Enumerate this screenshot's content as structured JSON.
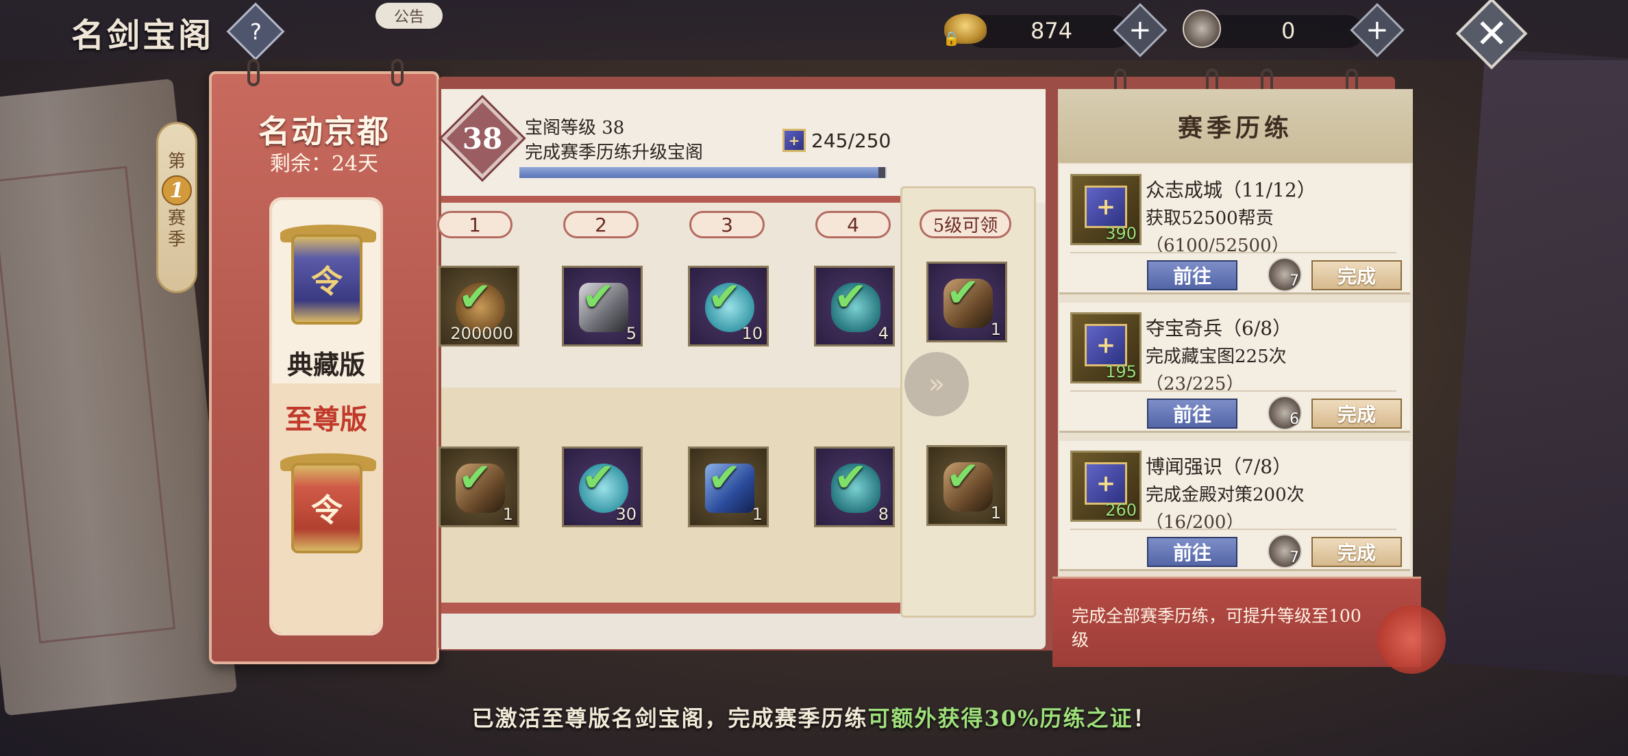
{
  "header": {
    "title": "名剑宝阁",
    "help_label": "?",
    "notice_tab": "公告",
    "currency_gold": {
      "value": "874",
      "icon": "gold-ingot-icon",
      "locked": true
    },
    "currency_key": {
      "value": "0",
      "icon": "key-token-icon"
    },
    "plus_label": "+",
    "close_label": "✕"
  },
  "season": {
    "prefix": "第",
    "number": "1",
    "suffix_1": "赛",
    "suffix_2": "季"
  },
  "left_panel": {
    "title": "名动京都",
    "remaining": "剩余：24天",
    "edition_collect": "典藏版",
    "edition_supreme": "至尊版",
    "lantern_char": "令"
  },
  "pass": {
    "level": "38",
    "level_label": "宝阁等级 38",
    "upgrade_hint": "完成赛季历练升级宝阁",
    "exp": "245/250",
    "exp_progress": 0.98,
    "level_tags": [
      "1",
      "2",
      "3",
      "4"
    ],
    "level5_tag": "5级可领",
    "next_arrow": "»",
    "top_row": [
      {
        "icon": "coin-bundle-icon",
        "count": "200000",
        "claimed": true
      },
      {
        "icon": "ore-stone-icon",
        "count": "5",
        "claimed": true
      },
      {
        "icon": "jade-stone-icon",
        "count": "10",
        "claimed": true
      },
      {
        "icon": "pouch-icon",
        "count": "4",
        "claimed": true
      }
    ],
    "top_level5": {
      "icon": "key-item-icon",
      "count": "1",
      "claimed": true
    },
    "bottom_row": [
      {
        "icon": "key-item-icon",
        "count": "1",
        "claimed": true
      },
      {
        "icon": "jade-stone-icon",
        "count": "30",
        "claimed": true
      },
      {
        "icon": "crystal-icon",
        "count": "1",
        "claimed": true
      },
      {
        "icon": "pouch-icon",
        "count": "8",
        "claimed": true
      }
    ],
    "bottom_level5": {
      "icon": "key-item-icon",
      "count": "1",
      "claimed": true
    }
  },
  "season_tasks": {
    "title": "赛季历练",
    "tasks": [
      {
        "name": "众志成城（11/12）",
        "desc": "获取52500帮贡",
        "progress": "（6100/52500）",
        "exp": "390",
        "reward_count": "7",
        "go_label": "前往",
        "done_label": "完成"
      },
      {
        "name": "夺宝奇兵（6/8）",
        "desc": "完成藏宝图225次",
        "progress": "（23/225）",
        "exp": "195",
        "reward_count": "6",
        "go_label": "前往",
        "done_label": "完成"
      },
      {
        "name": "博闻强识（7/8）",
        "desc": "完成金殿对策200次",
        "progress": "（16/200）",
        "exp": "260",
        "reward_count": "7",
        "go_label": "前往",
        "done_label": "完成"
      }
    ],
    "footer_text": "完成全部赛季历练，可提升等级至100级"
  },
  "bottom_notice": {
    "part1": "已激活至尊版名剑宝阁，完成赛季历练",
    "part2": "可额外获得30%历练之证",
    "part3": "！"
  },
  "colors": {
    "panel_red": "#b3574d",
    "go_button_blue": "#5366a6",
    "highlight_green": "#9ee07a",
    "supreme_red": "#c0392b"
  }
}
